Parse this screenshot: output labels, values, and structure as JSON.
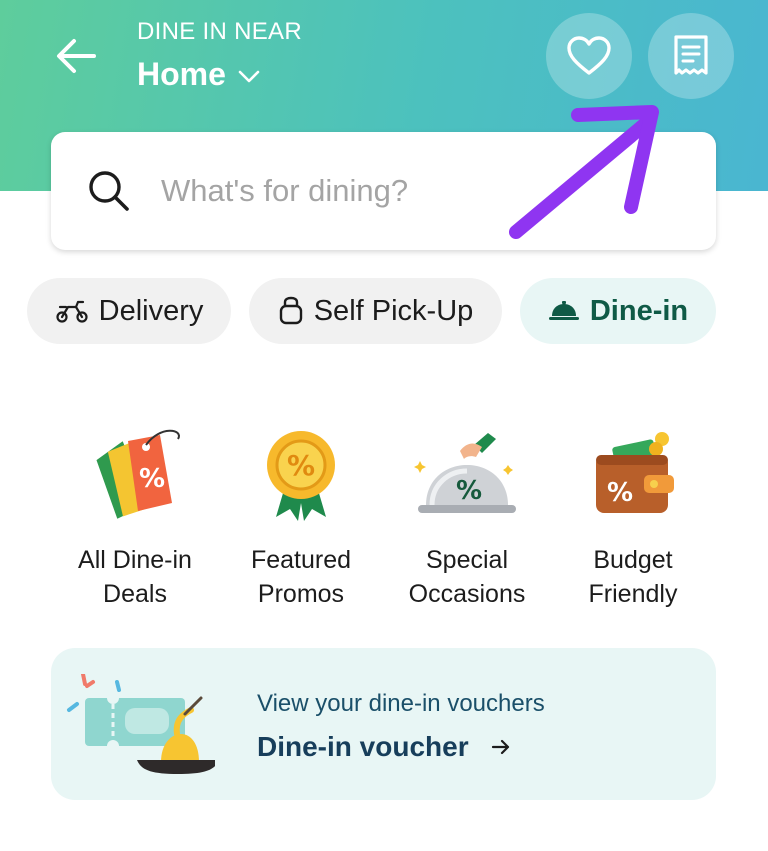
{
  "header": {
    "location_label": "DINE IN NEAR",
    "location_value": "Home",
    "icons": {
      "back": "back-arrow-icon",
      "chevron": "chevron-down-icon",
      "favorites": "heart-icon",
      "orders": "receipt-icon"
    }
  },
  "search": {
    "placeholder": "What's for dining?",
    "value": ""
  },
  "modes": [
    {
      "label": "Delivery",
      "icon": "scooter-icon",
      "selected": false
    },
    {
      "label": "Self Pick-Up",
      "icon": "bag-icon",
      "selected": false
    },
    {
      "label": "Dine-in",
      "icon": "cloche-icon",
      "selected": true
    }
  ],
  "categories": [
    {
      "line1": "All Dine-in",
      "line2": "Deals",
      "icon": "price-tags-icon"
    },
    {
      "line1": "Featured",
      "line2": "Promos",
      "icon": "award-badge-icon"
    },
    {
      "line1": "Special",
      "line2": "Occasions",
      "icon": "serving-cloche-icon"
    },
    {
      "line1": "Budget",
      "line2": "Friendly",
      "icon": "wallet-icon"
    }
  ],
  "voucher_card": {
    "subtitle": "View your dine-in vouchers",
    "title": "Dine-in voucher"
  },
  "colors": {
    "header_gradient": [
      "#5ecd9c",
      "#4ab6d1"
    ],
    "dinein_accent": "#0f5a46",
    "annotation_arrow": "#8f35f1"
  }
}
